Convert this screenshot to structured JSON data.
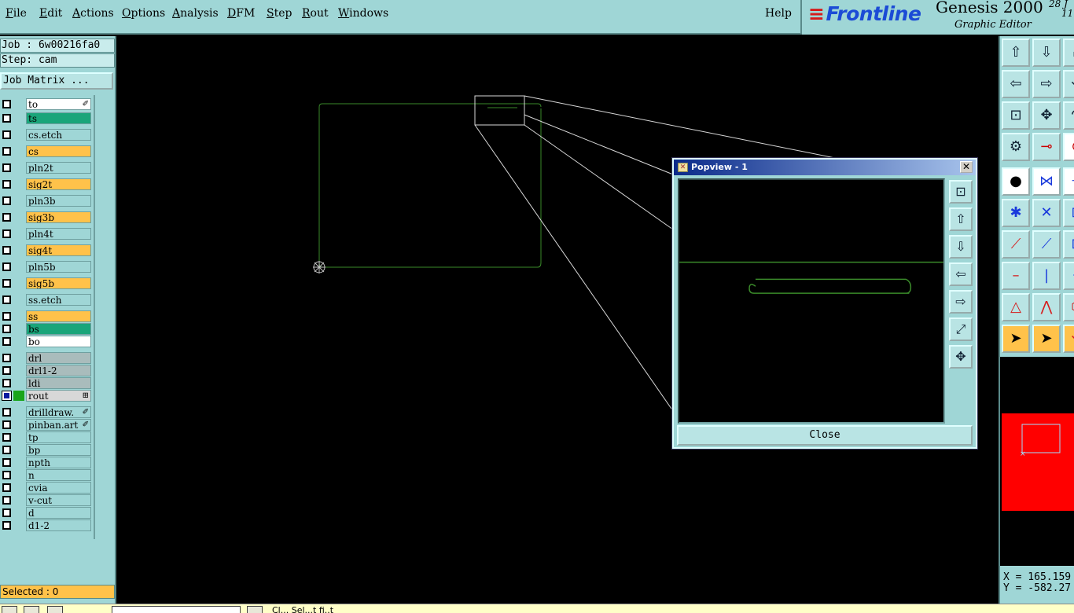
{
  "menu": {
    "items": [
      {
        "label": "File",
        "ul": "F",
        "rest": "ile"
      },
      {
        "label": "Edit",
        "ul": "E",
        "rest": "dit"
      },
      {
        "label": "Actions",
        "ul": "A",
        "rest": "ctions"
      },
      {
        "label": "Options",
        "ul": "O",
        "rest": "ptions"
      },
      {
        "label": "Analysis",
        "ul": "A",
        "rest": "nalysis"
      },
      {
        "label": "DFM",
        "ul": "D",
        "rest": "FM"
      },
      {
        "label": "Step",
        "ul": "S",
        "rest": "tep"
      },
      {
        "label": "Rout",
        "ul": "R",
        "rest": "out"
      },
      {
        "label": "Windows",
        "ul": "W",
        "rest": "indows"
      }
    ],
    "help": "Help"
  },
  "brand": {
    "logo": "Frontline",
    "product": "Genesis 2000",
    "subtitle": "Graphic Editor",
    "date": "28 J",
    "time": "11:"
  },
  "job": {
    "job_line": "Job : 6w00216fa0",
    "step_line": "Step: cam",
    "matrix_button": "Job Matrix ..."
  },
  "layers": [
    {
      "name": "to",
      "color": "#ffffff",
      "suffix": "✐",
      "mark": "",
      "checked": false
    },
    {
      "name": "ts",
      "color": "#1aa57a",
      "suffix": "",
      "mark": "",
      "checked": false
    },
    {
      "name": "cs.etch",
      "color": "#9fd6d6",
      "suffix": "",
      "mark": "",
      "checked": false
    },
    {
      "name": "cs",
      "color": "#ffc24a",
      "suffix": "",
      "mark": "",
      "checked": false
    },
    {
      "name": "pln2t",
      "color": "#9fd6d6",
      "suffix": "",
      "mark": "",
      "checked": false
    },
    {
      "name": "sig2t",
      "color": "#ffc24a",
      "suffix": "",
      "mark": "",
      "checked": false
    },
    {
      "name": "pln3b",
      "color": "#9fd6d6",
      "suffix": "",
      "mark": "",
      "checked": false
    },
    {
      "name": "sig3b",
      "color": "#ffc24a",
      "suffix": "",
      "mark": "",
      "checked": false
    },
    {
      "name": "pln4t",
      "color": "#9fd6d6",
      "suffix": "",
      "mark": "",
      "checked": false
    },
    {
      "name": "sig4t",
      "color": "#ffc24a",
      "suffix": "",
      "mark": "",
      "checked": false
    },
    {
      "name": "pln5b",
      "color": "#9fd6d6",
      "suffix": "",
      "mark": "",
      "checked": false
    },
    {
      "name": "sig5b",
      "color": "#ffc24a",
      "suffix": "",
      "mark": "",
      "checked": false
    },
    {
      "name": "ss.etch",
      "color": "#9fd6d6",
      "suffix": "",
      "mark": "",
      "checked": false
    },
    {
      "name": "ss",
      "color": "#ffc24a",
      "suffix": "",
      "mark": "",
      "checked": false
    },
    {
      "name": "bs",
      "color": "#1aa57a",
      "suffix": "",
      "mark": "",
      "checked": false
    },
    {
      "name": "bo",
      "color": "#ffffff",
      "suffix": "",
      "mark": "",
      "checked": false
    },
    {
      "name": "drl",
      "color": "#a9bcbc",
      "suffix": "",
      "mark": "",
      "checked": false
    },
    {
      "name": "drl1-2",
      "color": "#a9bcbc",
      "suffix": "",
      "mark": "",
      "checked": false
    },
    {
      "name": "ldi",
      "color": "#a9bcbc",
      "suffix": "",
      "mark": "",
      "checked": false
    },
    {
      "name": "rout",
      "color": "#d8d8d8",
      "suffix": "⊞",
      "mark": "#1aa51a",
      "checked": true
    },
    {
      "name": "drilldraw.",
      "color": "#9fd6d6",
      "suffix": "✐",
      "mark": "",
      "checked": false
    },
    {
      "name": "pinban.art",
      "color": "#9fd6d6",
      "suffix": "✐",
      "mark": "",
      "checked": false
    },
    {
      "name": "tp",
      "color": "#9fd6d6",
      "suffix": "",
      "mark": "",
      "checked": false
    },
    {
      "name": "bp",
      "color": "#9fd6d6",
      "suffix": "",
      "mark": "",
      "checked": false
    },
    {
      "name": "npth",
      "color": "#9fd6d6",
      "suffix": "",
      "mark": "",
      "checked": false
    },
    {
      "name": "n",
      "color": "#9fd6d6",
      "suffix": "",
      "mark": "",
      "checked": false
    },
    {
      "name": "cvia",
      "color": "#9fd6d6",
      "suffix": "",
      "mark": "",
      "checked": false
    },
    {
      "name": "v-cut",
      "color": "#9fd6d6",
      "suffix": "",
      "mark": "",
      "checked": false
    },
    {
      "name": "d",
      "color": "#9fd6d6",
      "suffix": "",
      "mark": "",
      "checked": false
    },
    {
      "name": "d1-2",
      "color": "#9fd6d6",
      "suffix": "",
      "mark": "",
      "checked": false
    }
  ],
  "status": {
    "selected": "Selected : 0",
    "prompt": "Cl... Sel...t fi..t"
  },
  "popview": {
    "title": "Popview - 1",
    "close_button": "Close",
    "close_x": "✕"
  },
  "coords": {
    "x": "X = 165.159",
    "y": "Y = -582.27"
  },
  "colors": {
    "panel": "#9fd6d6",
    "profile_line": "#3a8a2a",
    "orange_layer": "#ffc24a",
    "green_layer": "#1aa57a",
    "overview_fill": "#ff0000"
  },
  "icons": {
    "popview_tools": [
      "zoom-home-icon",
      "pan-up-icon",
      "pan-down-icon",
      "pan-left-icon",
      "pan-right-icon",
      "zoom-fit-icon",
      "zoom-center-icon"
    ],
    "right_tools": [
      "zoom-up-icon",
      "zoom-down-icon",
      "zoom-home-icon",
      "pan-left-icon",
      "pan-right-icon",
      "undo-icon",
      "fit-icon",
      "center-icon",
      "redo-icon",
      "properties-icon",
      "measure-icon",
      "snap-icon",
      "feature-icon",
      "net-icon",
      "route-icon",
      "graph-icon",
      "intersect-icon",
      "grid-icon",
      "line-icon",
      "line-select-icon",
      "pad-icon",
      "pad-add-icon",
      "segment-icon",
      "cut-icon",
      "triangle-icon",
      "arrow-icon",
      "polygon-icon",
      "select-icon",
      "select-active-icon",
      "rotate-icon"
    ]
  }
}
